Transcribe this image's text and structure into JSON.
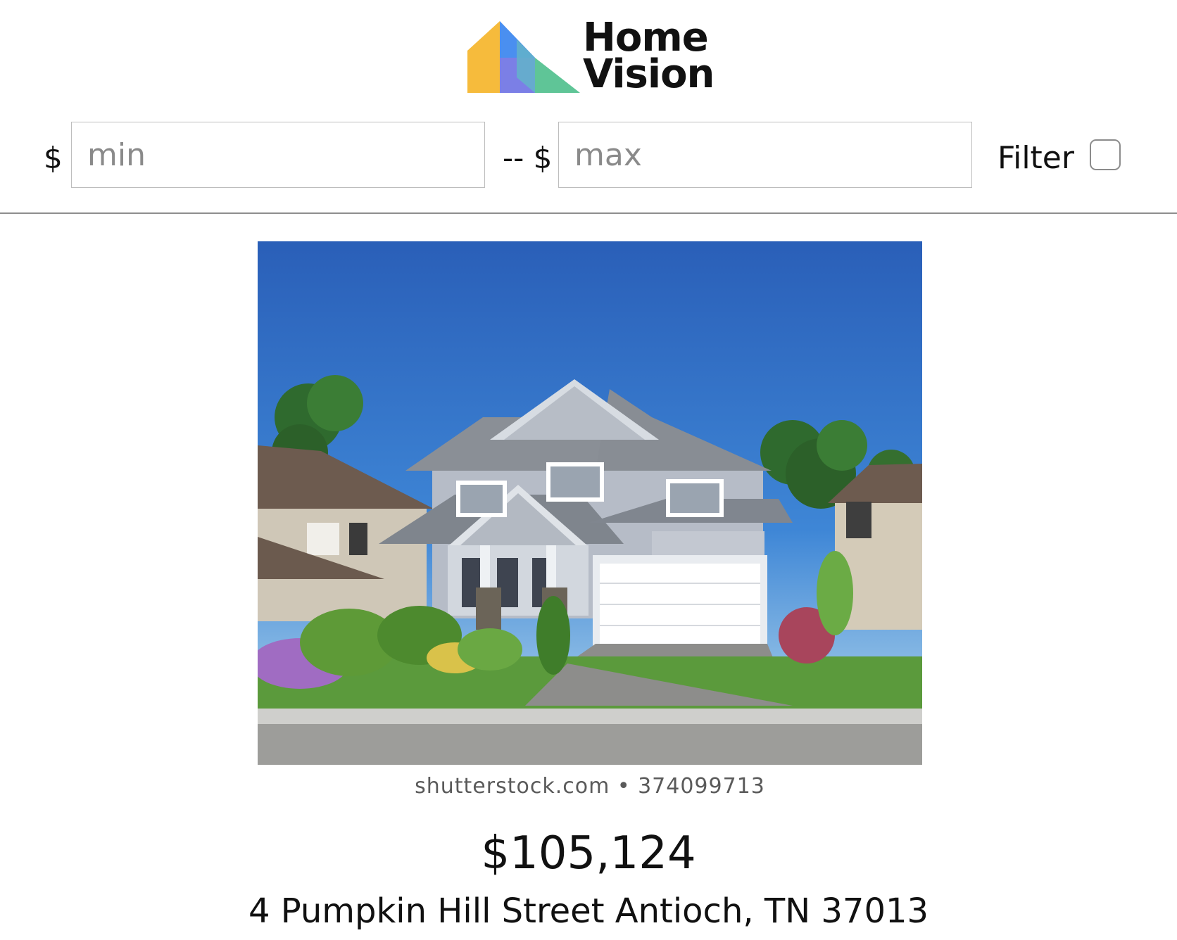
{
  "header": {
    "logo_line1": "Home",
    "logo_line2": "Vision",
    "logo_colors": [
      "#f6bb3c",
      "#4a8ff0",
      "#5fc597",
      "#7b7fe6"
    ]
  },
  "filter": {
    "min_currency": "$",
    "min_placeholder": "min",
    "separator": "-- $",
    "max_placeholder": "max",
    "filter_label": "Filter",
    "filter_checked": false
  },
  "listing": {
    "photo_credit": "shutterstock.com • 374099713",
    "price": "$105,124",
    "address": "4 Pumpkin Hill Street Antioch, TN 37013"
  }
}
